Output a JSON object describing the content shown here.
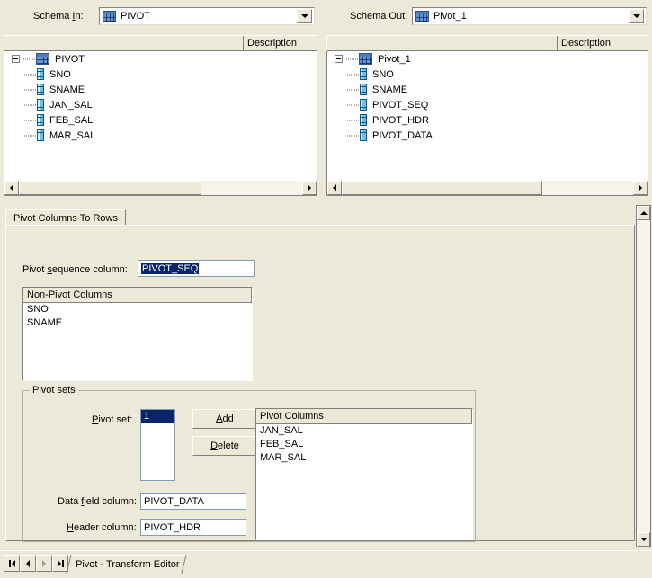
{
  "window": {
    "title": "Pivot - Transform Editor"
  },
  "schema_in": {
    "label": "Schema In:",
    "label_accel": "I",
    "value": "PIVOT",
    "icon": "table-grid-icon",
    "dropdown_icon": "chevron-down-icon",
    "columns": [
      "",
      "Description"
    ],
    "tree": [
      {
        "label": "PIVOT",
        "type": "table",
        "level": 0,
        "expanded": true
      },
      {
        "label": "SNO",
        "type": "column",
        "level": 1
      },
      {
        "label": "SNAME",
        "type": "column",
        "level": 1
      },
      {
        "label": "JAN_SAL",
        "type": "column",
        "level": 1
      },
      {
        "label": "FEB_SAL",
        "type": "column",
        "level": 1
      },
      {
        "label": "MAR_SAL",
        "type": "column",
        "level": 1
      }
    ]
  },
  "schema_out": {
    "label": "Schema Out:",
    "value": "Pivot_1",
    "icon": "table-grid-icon",
    "dropdown_icon": "chevron-down-icon",
    "columns": [
      "",
      "Description"
    ],
    "tree": [
      {
        "label": "Pivot_1",
        "type": "table",
        "level": 0,
        "expanded": true
      },
      {
        "label": "SNO",
        "type": "column",
        "level": 1
      },
      {
        "label": "SNAME",
        "type": "column",
        "level": 1
      },
      {
        "label": "PIVOT_SEQ",
        "type": "column",
        "level": 1
      },
      {
        "label": "PIVOT_HDR",
        "type": "column",
        "level": 1
      },
      {
        "label": "PIVOT_DATA",
        "type": "column",
        "level": 1
      }
    ]
  },
  "editor": {
    "tabs": [
      {
        "label": "Pivot Columns To Rows",
        "active": true
      }
    ],
    "pivot_sequence": {
      "label": "Pivot sequence column:",
      "value": "PIVOT_SEQ",
      "selected": true
    },
    "non_pivot_columns": {
      "header": "Non-Pivot Columns",
      "items": [
        "SNO",
        "SNAME"
      ]
    },
    "pivot_sets": {
      "title": "Pivot sets",
      "pivot_set_label": "Pivot set:",
      "pivot_set_items": [
        "1"
      ],
      "pivot_set_selected": "1",
      "add_label": "Add",
      "delete_label": "Delete",
      "pivot_columns": {
        "header": "Pivot Columns",
        "items": [
          "JAN_SAL",
          "FEB_SAL",
          "MAR_SAL"
        ]
      },
      "data_field": {
        "label": "Data field column:",
        "value": "PIVOT_DATA"
      },
      "header_field": {
        "label": "Header column:",
        "value": "PIVOT_HDR"
      }
    }
  },
  "bottom": {
    "nav": [
      {
        "name": "first-record-button",
        "icon": "nav-first-icon"
      },
      {
        "name": "previous-record-button",
        "icon": "nav-prev-icon"
      },
      {
        "name": "next-record-button",
        "icon": "nav-next-icon"
      },
      {
        "name": "last-record-button",
        "icon": "nav-last-icon"
      }
    ],
    "sheet_tab": "Pivot - Transform Editor"
  },
  "colors": {
    "face": "#ece9d8",
    "selection": "#0a246a",
    "field_border": "#7f9db9"
  }
}
